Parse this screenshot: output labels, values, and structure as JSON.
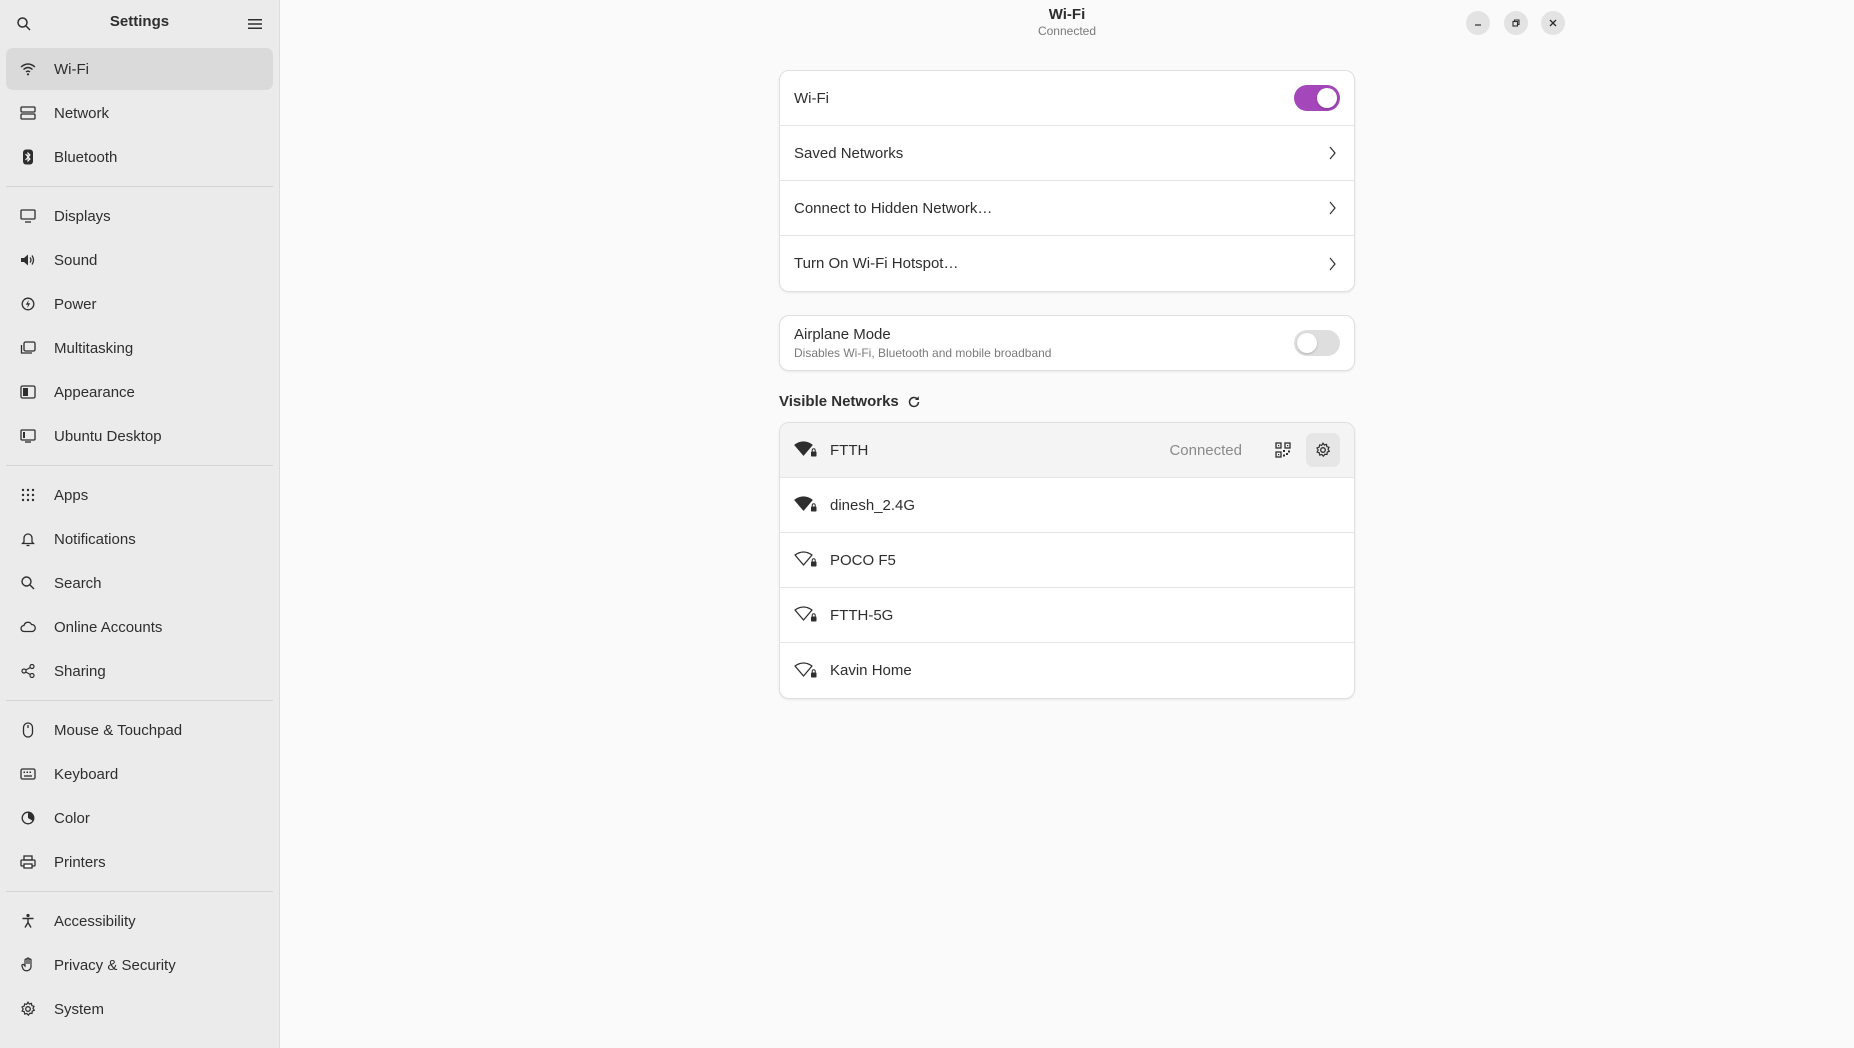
{
  "sidebar": {
    "title": "Settings",
    "groups": [
      [
        {
          "label": "Wi-Fi",
          "icon": "wifi-icon",
          "active": true
        },
        {
          "label": "Network",
          "icon": "network-icon"
        },
        {
          "label": "Bluetooth",
          "icon": "bluetooth-icon"
        }
      ],
      [
        {
          "label": "Displays",
          "icon": "display-icon"
        },
        {
          "label": "Sound",
          "icon": "speaker-icon"
        },
        {
          "label": "Power",
          "icon": "power-icon"
        },
        {
          "label": "Multitasking",
          "icon": "multitasking-icon"
        },
        {
          "label": "Appearance",
          "icon": "appearance-icon"
        },
        {
          "label": "Ubuntu Desktop",
          "icon": "ubuntu-desktop-icon"
        }
      ],
      [
        {
          "label": "Apps",
          "icon": "apps-grid-icon"
        },
        {
          "label": "Notifications",
          "icon": "bell-icon"
        },
        {
          "label": "Search",
          "icon": "search-icon"
        },
        {
          "label": "Online Accounts",
          "icon": "cloud-icon"
        },
        {
          "label": "Sharing",
          "icon": "share-icon"
        }
      ],
      [
        {
          "label": "Mouse & Touchpad",
          "icon": "mouse-icon"
        },
        {
          "label": "Keyboard",
          "icon": "keyboard-icon"
        },
        {
          "label": "Color",
          "icon": "color-icon"
        },
        {
          "label": "Printers",
          "icon": "printer-icon"
        }
      ],
      [
        {
          "label": "Accessibility",
          "icon": "accessibility-icon"
        },
        {
          "label": "Privacy & Security",
          "icon": "hand-icon"
        },
        {
          "label": "System",
          "icon": "gear-icon"
        }
      ]
    ]
  },
  "header": {
    "title": "Wi-Fi",
    "subtitle": "Connected"
  },
  "wifi_card": {
    "wifi_label": "Wi-Fi",
    "wifi_enabled": true,
    "saved_networks": "Saved Networks",
    "hidden_network": "Connect to Hidden Network…",
    "hotspot": "Turn On Wi-Fi Hotspot…"
  },
  "airplane": {
    "label": "Airplane Mode",
    "description": "Disables Wi-Fi, Bluetooth and mobile broadband",
    "enabled": false
  },
  "visible_networks": {
    "title": "Visible Networks",
    "networks": [
      {
        "name": "FTTH",
        "status": "Connected",
        "signal": "strong"
      },
      {
        "name": "dinesh_2.4G",
        "status": "",
        "signal": "strong"
      },
      {
        "name": "POCO F5",
        "status": "",
        "signal": "weak"
      },
      {
        "name": "FTTH-5G",
        "status": "",
        "signal": "weak"
      },
      {
        "name": "Kavin Home",
        "status": "",
        "signal": "weak"
      }
    ]
  },
  "colors": {
    "accent": "#a347ba",
    "sidebar_bg": "#ebebeb",
    "content_bg": "#fafafa"
  }
}
